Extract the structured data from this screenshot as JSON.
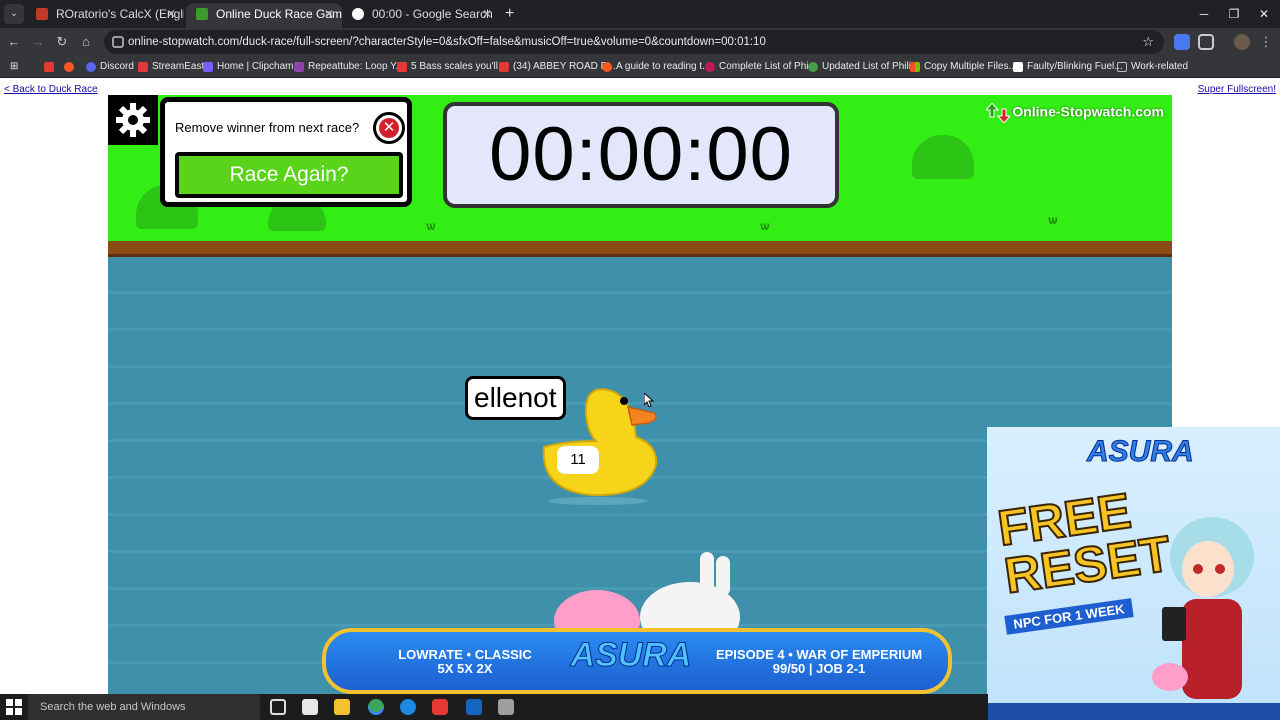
{
  "browser": {
    "tabs": [
      {
        "title": "ROratorio's CalcX (English Versi",
        "active": false,
        "favicon_color": "#c0392b"
      },
      {
        "title": "Online Duck Race Game",
        "active": true,
        "favicon_color": "#3b9b2e"
      },
      {
        "title": "00:00 - Google Search",
        "active": false,
        "favicon_color": "#ffffff"
      }
    ],
    "url": "online-stopwatch.com/duck-race/full-screen/?characterStyle=0&sfxOff=false&musicOff=true&volume=0&countdown=00:01:10",
    "bookmarks": [
      {
        "label": "",
        "color": "#e53935"
      },
      {
        "label": "",
        "color": "#ff5722"
      },
      {
        "label": "Discord",
        "color": "#5865f2"
      },
      {
        "label": "StreamEast",
        "color": "#e53935"
      },
      {
        "label": "Home | Clipchamp",
        "color": "#7b5cff"
      },
      {
        "label": "Repeattube: Loop Y...",
        "color": "#8e44ad"
      },
      {
        "label": "5 Bass scales you'll...",
        "color": "#e53935"
      },
      {
        "label": "(34) ABBEY ROAD B...",
        "color": "#e53935"
      },
      {
        "label": "A guide to reading t...",
        "color": "#ff5722"
      },
      {
        "label": "Complete List of Phi...",
        "color": "#c2185b"
      },
      {
        "label": "Updated List of Phili...",
        "color": "#43a047"
      },
      {
        "label": "Copy Multiple Files...",
        "color": "#f4b400"
      },
      {
        "label": "Faulty/Blinking Fuel...",
        "color": "#ffffff"
      },
      {
        "label": "Work-related",
        "color": "#bdbdbd"
      }
    ]
  },
  "page": {
    "back_link": "< Back to Duck Race",
    "fullscreen_link": "Super Fullscreen!"
  },
  "game": {
    "remove_winner_label": "Remove winner from next race?",
    "race_again_label": "Race Again?",
    "timer": "00:00:00",
    "brand": "Online-Stopwatch.com",
    "duck": {
      "name": "ellenot",
      "number": "11"
    }
  },
  "ads": {
    "banner": {
      "left_line1": "LOWRATE • CLASSIC",
      "left_line2": "5X 5X 2X",
      "logo": "ASURA",
      "right_line1": "EPISODE 4 • WAR OF EMPERIUM",
      "right_line2": "99/50 | JOB 2-1"
    },
    "side": {
      "logo": "ASURA",
      "headline1": "FREE",
      "headline2": "RESET",
      "subline": "NPC FOR 1 WEEK"
    }
  },
  "taskbar": {
    "search_placeholder": "Search the web and Windows"
  },
  "colors": {
    "grass": "#33ee14",
    "water": "#3f91ab",
    "race_button": "#5ad41a",
    "timer_bg": "#e4e6fb"
  }
}
